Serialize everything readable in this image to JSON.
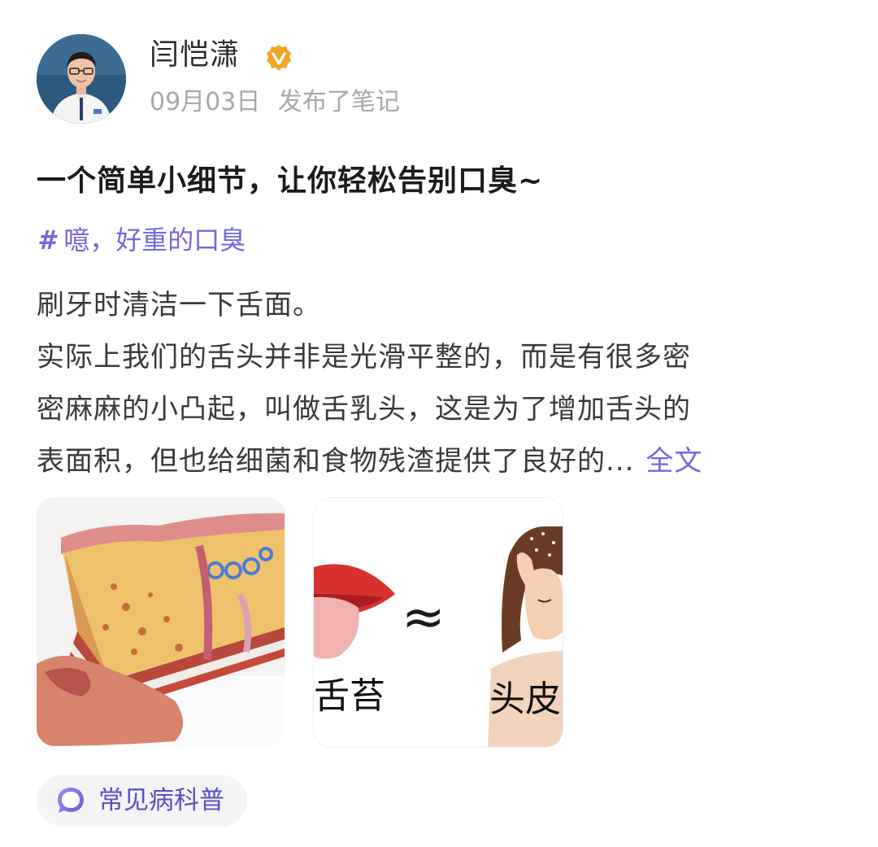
{
  "author": {
    "name": "闫恺潇",
    "date": "09月03日",
    "action": "发布了笔记"
  },
  "post": {
    "title": "一个简单小细节，让你轻松告别口臭~",
    "topic_symbol": "#",
    "topic": "噫，好重的口臭",
    "lines": [
      "刷牙时清洁一下舌面。",
      "实际上我们的舌头并非是光滑平整的，而是有很多密",
      "密麻麻的小凸起，叫做舌乳头，这是为了增加舌头的",
      "表面积，但也给细菌和食物残渣提供了良好的..."
    ],
    "full_link": "全文"
  },
  "images": {
    "second": {
      "left_label": "舌苔",
      "approx_symbol": "≈",
      "right_label": "头皮"
    }
  },
  "category": {
    "label": "常见病科普"
  },
  "colors": {
    "accent": "#7468e0",
    "verified": "#f3a524",
    "muted": "#a8a8a8"
  }
}
